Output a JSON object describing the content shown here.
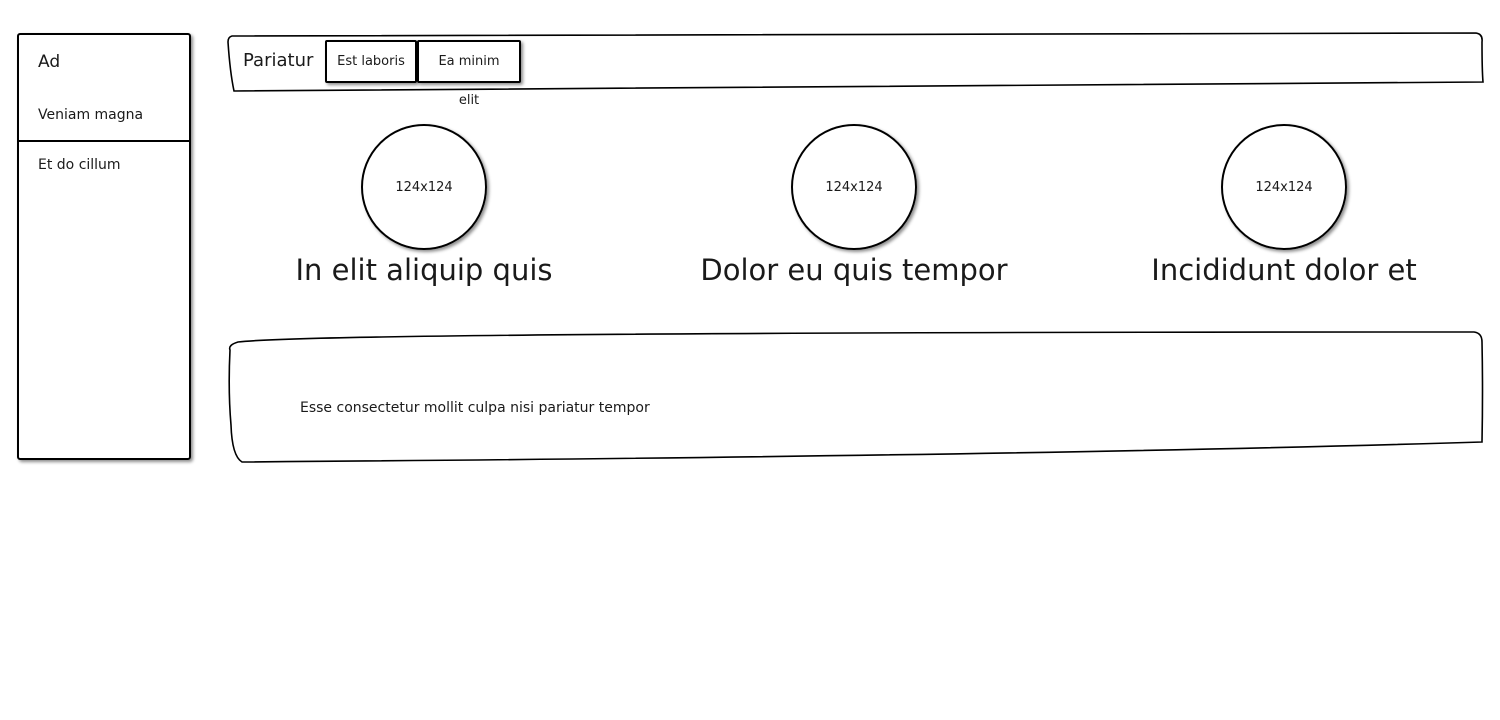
{
  "sidebar": {
    "title": "Ad",
    "items": [
      {
        "label": "Veniam magna"
      },
      {
        "label": "Et do cillum"
      }
    ]
  },
  "topbar": {
    "title": "Pariatur",
    "buttons": [
      {
        "label": "Est laboris"
      },
      {
        "label": "Ea minim elit"
      }
    ]
  },
  "cards": [
    {
      "image_label": "124x124",
      "caption": "In elit aliquip quis"
    },
    {
      "image_label": "124x124",
      "caption": "Dolor eu quis tempor"
    },
    {
      "image_label": "124x124",
      "caption": "Incididunt dolor et"
    }
  ],
  "panel": {
    "text": "Esse consectetur mollit culpa nisi pariatur tempor"
  }
}
